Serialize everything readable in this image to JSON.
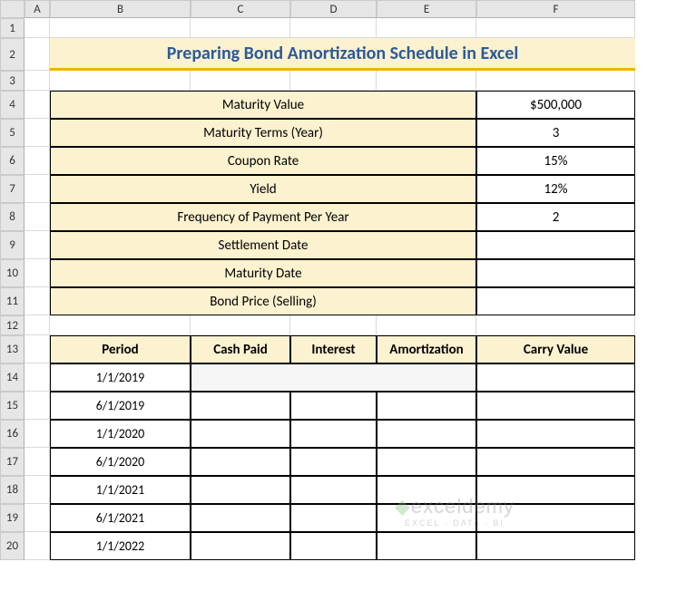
{
  "columns": [
    "A",
    "B",
    "C",
    "D",
    "E",
    "F"
  ],
  "rows": [
    "1",
    "2",
    "3",
    "4",
    "5",
    "6",
    "7",
    "8",
    "9",
    "10",
    "11",
    "12",
    "13",
    "14",
    "15",
    "16",
    "17",
    "18",
    "19",
    "20"
  ],
  "title": "Preparing Bond Amortization Schedule in Excel",
  "params": [
    {
      "label": "Maturity Value",
      "value": "$500,000"
    },
    {
      "label": "Maturity Terms (Year)",
      "value": "3"
    },
    {
      "label": "Coupon Rate",
      "value": "15%"
    },
    {
      "label": "Yield",
      "value": "12%"
    },
    {
      "label": "Frequency of Payment Per Year",
      "value": "2"
    },
    {
      "label": "Settlement Date",
      "value": ""
    },
    {
      "label": "Maturity Date",
      "value": ""
    },
    {
      "label": "Bond Price (Selling)",
      "value": ""
    }
  ],
  "schedule": {
    "headers": [
      "Period",
      "Cash Paid",
      "Interest",
      "Amortization",
      "Carry Value"
    ],
    "rows": [
      {
        "period": "1/1/2019"
      },
      {
        "period": "6/1/2019"
      },
      {
        "period": "1/1/2020"
      },
      {
        "period": "6/1/2020"
      },
      {
        "period": "1/1/2021"
      },
      {
        "period": "6/1/2021"
      },
      {
        "period": "1/1/2022"
      }
    ]
  },
  "watermark": {
    "brand": "exceldemy",
    "tag": "EXCEL · DATA · BI"
  },
  "chart_data": {
    "type": "table",
    "title": "Bond Amortization Schedule",
    "parameters": {
      "Maturity Value": 500000,
      "Maturity Terms (Year)": 3,
      "Coupon Rate": 0.15,
      "Yield": 0.12,
      "Frequency of Payment Per Year": 2
    },
    "columns": [
      "Period",
      "Cash Paid",
      "Interest",
      "Amortization",
      "Carry Value"
    ],
    "periods": [
      "1/1/2019",
      "6/1/2019",
      "1/1/2020",
      "6/1/2020",
      "1/1/2021",
      "6/1/2021",
      "1/1/2022"
    ]
  }
}
